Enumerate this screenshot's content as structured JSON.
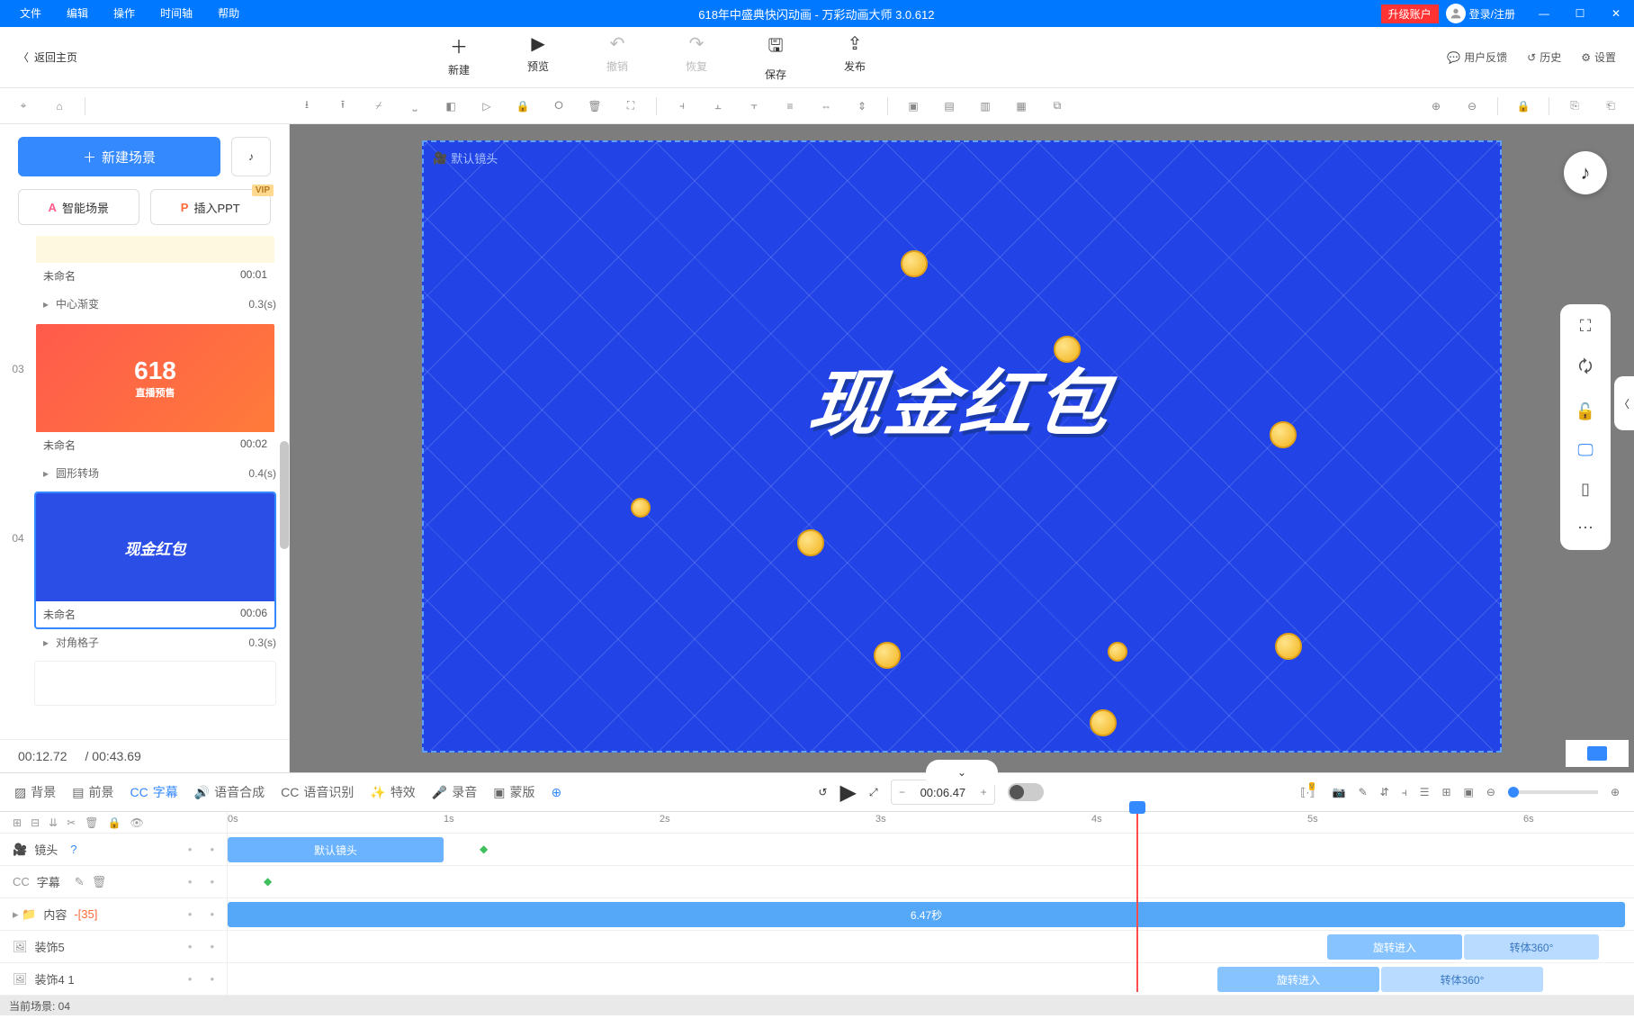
{
  "titlebar": {
    "menus": [
      "文件",
      "编辑",
      "操作",
      "时间轴",
      "帮助"
    ],
    "title": "618年中盛典快闪动画 - 万彩动画大师 3.0.612",
    "upgrade": "升级账户",
    "login": "登录/注册"
  },
  "actionbar": {
    "back": "返回主页",
    "buttons": [
      {
        "icon": "＋",
        "label": "新建"
      },
      {
        "icon": "▶",
        "label": "预览"
      },
      {
        "icon": "↶",
        "label": "撤销",
        "disabled": true
      },
      {
        "icon": "↷",
        "label": "恢复",
        "disabled": true
      },
      {
        "icon": "🖫",
        "label": "保存"
      },
      {
        "icon": "⇪",
        "label": "发布"
      }
    ],
    "right": [
      {
        "icon": "💬",
        "label": "用户反馈"
      },
      {
        "icon": "↺",
        "label": "历史"
      },
      {
        "icon": "⚙",
        "label": "设置"
      }
    ]
  },
  "sidebar": {
    "new_scene": "新建场景",
    "ai_scene": "智能场景",
    "insert_ppt": "插入PPT",
    "vip": "VIP",
    "scenes": [
      {
        "num": "",
        "name": "未命名",
        "time": "00:01",
        "trans": "中心渐变",
        "trans_time": "0.3(s)",
        "thumb": "preview"
      },
      {
        "num": "03",
        "name": "未命名",
        "time": "00:02",
        "trans": "圆形转场",
        "trans_time": "0.4(s)",
        "thumb": "618"
      },
      {
        "num": "04",
        "name": "未命名",
        "time": "00:06",
        "trans": "对角格子",
        "trans_time": "0.3(s)",
        "thumb": "cash",
        "selected": true
      }
    ],
    "current_time": "00:12.72",
    "total_time": "/ 00:43.69"
  },
  "canvas": {
    "camera_label": "默认镜头",
    "big_text": "现金红包"
  },
  "timeline_tabs": {
    "tabs": [
      {
        "icon": "▨",
        "label": "背景"
      },
      {
        "icon": "▤",
        "label": "前景"
      },
      {
        "icon": "CC",
        "label": "字幕",
        "active": true
      },
      {
        "icon": "🔊",
        "label": "语音合成"
      },
      {
        "icon": "CC",
        "label": "语音识别"
      },
      {
        "icon": "✨",
        "label": "特效"
      },
      {
        "icon": "🎤",
        "label": "录音"
      },
      {
        "icon": "▣",
        "label": "蒙版"
      },
      {
        "icon": "⋯",
        "label": ""
      }
    ],
    "time_value": "00:06.47"
  },
  "ruler": [
    "0s",
    "1s",
    "2s",
    "3s",
    "4s",
    "5s",
    "6s"
  ],
  "tracks": {
    "camera": {
      "label": "镜头",
      "bar_label": "默认镜头"
    },
    "subtitle": {
      "label": "字幕"
    },
    "content": {
      "label": "内容",
      "count": "-[35]",
      "bar_label": "6.47秒"
    },
    "deco5": {
      "label": "装饰5",
      "effect1": "旋转进入",
      "effect2": "转体360°"
    },
    "deco41": {
      "label": "装饰4 1",
      "effect1": "旋转进入",
      "effect2": "转体360°"
    }
  },
  "statusbar": {
    "label": "当前场景: 04"
  }
}
